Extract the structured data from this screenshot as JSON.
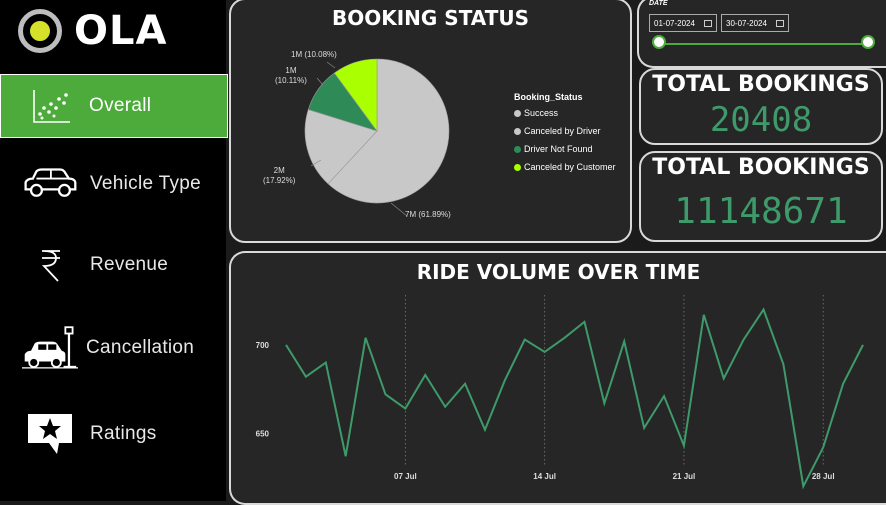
{
  "app": {
    "logo_text": "OLA"
  },
  "sidebar": {
    "items": [
      {
        "label": "Overall",
        "icon": "scatter-chart-icon",
        "active": true
      },
      {
        "label": "Vehicle Type",
        "icon": "car-icon",
        "active": false
      },
      {
        "label": "Revenue",
        "icon": "rupee-icon",
        "active": false
      },
      {
        "label": "Cancellation",
        "icon": "car-crash-icon",
        "active": false
      },
      {
        "label": "Ratings",
        "icon": "star-message-icon",
        "active": false
      }
    ]
  },
  "booking_status": {
    "title": "BOOKING STATUS",
    "legend_title": "Booking_Status",
    "slice_labels": {
      "success": "7M (61.89%)",
      "canceled_by_driver": "2M\n(17.92%)",
      "driver_not_found": "1M\n(10.11%)",
      "canceled_by_customer": "1M (10.08%)"
    }
  },
  "date_filter": {
    "label": "DATE",
    "start": "01-07-2024",
    "end": "30-07-2024",
    "range": [
      0,
      1
    ]
  },
  "kpis": [
    {
      "title": "TOTAL BOOKINGS",
      "value": "20408"
    },
    {
      "title": "TOTAL BOOKINGS",
      "value": "11148671"
    }
  ],
  "ride_volume": {
    "title": "RIDE VOLUME OVER TIME"
  },
  "colors": {
    "accent_green": "#4cab3b",
    "line_green": "#3e9a6a",
    "success": "#c8c8c8",
    "canceled_by_driver": "#c8c8c8",
    "driver_not_found": "#2e8b57",
    "canceled_by_customer": "#aaff00"
  },
  "chart_data": [
    {
      "type": "pie",
      "title": "BOOKING STATUS",
      "legend_title": "Booking_Status",
      "legend_position": "right",
      "categories": [
        "Success",
        "Canceled by Driver",
        "Driver Not Found",
        "Canceled by Customer"
      ],
      "values": [
        61.89,
        17.92,
        10.11,
        10.08
      ],
      "colors": [
        "#c8c8c8",
        "#c8c8c8",
        "#2e8b57",
        "#aaff00"
      ]
    },
    {
      "type": "line",
      "title": "RIDE VOLUME OVER TIME",
      "x": [
        "01 Jul",
        "02 Jul",
        "03 Jul",
        "04 Jul",
        "05 Jul",
        "06 Jul",
        "07 Jul",
        "08 Jul",
        "09 Jul",
        "10 Jul",
        "11 Jul",
        "12 Jul",
        "13 Jul",
        "14 Jul",
        "15 Jul",
        "16 Jul",
        "17 Jul",
        "18 Jul",
        "19 Jul",
        "20 Jul",
        "21 Jul",
        "22 Jul",
        "23 Jul",
        "24 Jul",
        "25 Jul",
        "26 Jul",
        "27 Jul",
        "28 Jul",
        "29 Jul",
        "30 Jul"
      ],
      "xticks": [
        "07 Jul",
        "14 Jul",
        "21 Jul",
        "28 Jul"
      ],
      "yticks": [
        650,
        700
      ],
      "ylim": [
        623,
        735
      ],
      "grid": "vertical",
      "series": [
        {
          "values": [
            700,
            682,
            690,
            637,
            704,
            672,
            664,
            683,
            665,
            678,
            652,
            680,
            703,
            696,
            704,
            713,
            667,
            702,
            653,
            671,
            643,
            717,
            681,
            703,
            720,
            689,
            620,
            642,
            678,
            700
          ]
        }
      ]
    }
  ]
}
